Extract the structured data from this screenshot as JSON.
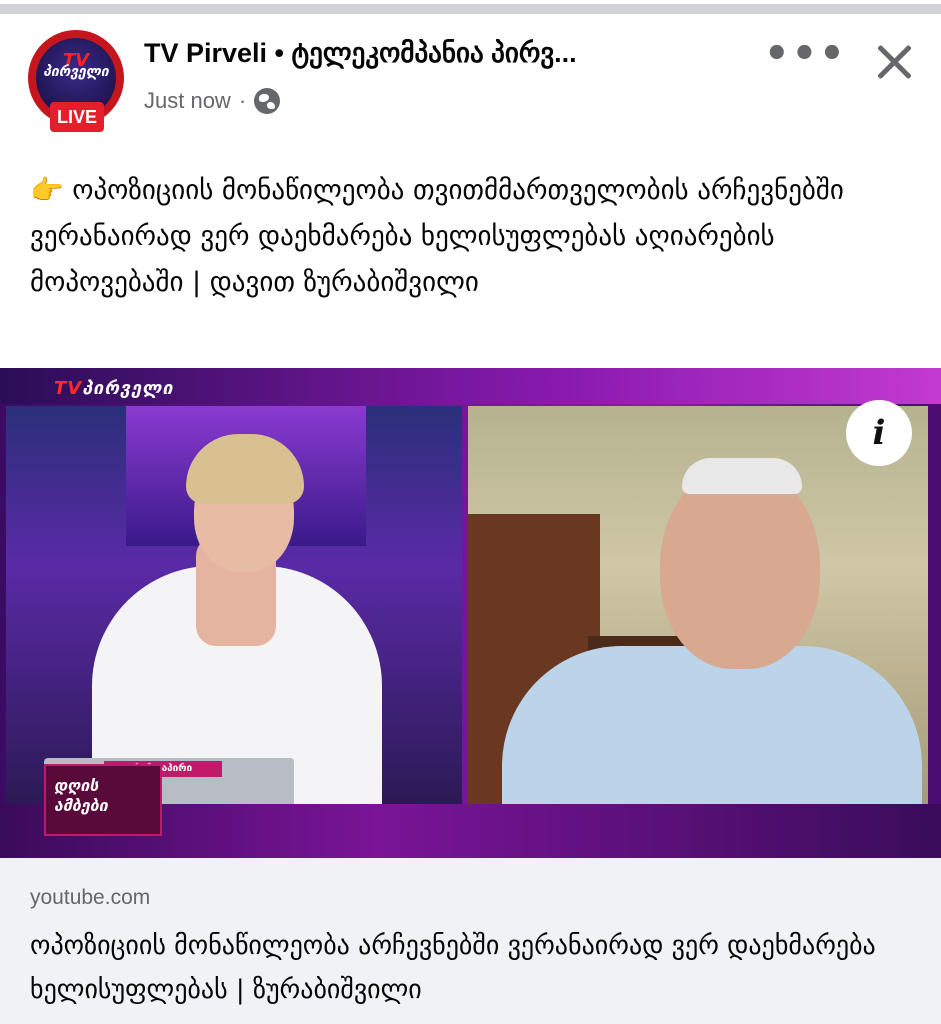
{
  "header": {
    "page_name": "TV Pirveli • ტელეკომპანია პირვ...",
    "time": "Just now",
    "separator": "·",
    "live_badge": "LIVE",
    "avatar_logo": "პირველი",
    "avatar_logo_tv": "TV",
    "more_icon": "more-horizontal-icon",
    "close_icon": "close-icon",
    "privacy_icon": "globe-icon"
  },
  "post": {
    "emoji": "👉",
    "text": "ოპოზიციის მონაწილეობა თვითმმართველობის არჩევნებში ვერანაირად ვერ დაეხმარება ხელისუფლებას აღიარების მოპოვებაში | დავით ზურაბიშვილი"
  },
  "media": {
    "channel_logo_tv": "TV",
    "channel_logo_text": "პირველი",
    "live_strip": "პირდაპირი",
    "show_badge": "დღის ამბები",
    "info_icon": "info-icon",
    "info_label": "i"
  },
  "link": {
    "domain": "youtube.com",
    "title": "ოპოზიციის მონაწილეობა არჩევნებში ვერანაირად ვერ დაეხმარება ხელისუფლებას | ზურაბიშვილი"
  }
}
